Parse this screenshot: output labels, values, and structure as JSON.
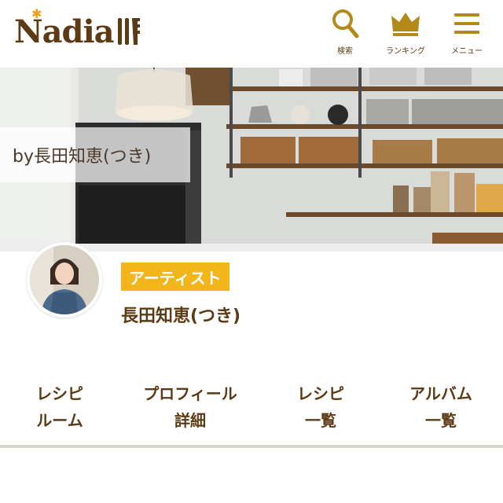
{
  "header": {
    "logo_text": "Nadia",
    "nav": {
      "search_label": "検索",
      "ranking_label": "ランキング",
      "menu_label": "メニュー"
    }
  },
  "cover": {
    "by_label": "by長田知恵(つき)"
  },
  "profile": {
    "tag": "アーティスト",
    "name": "長田知恵(つき)"
  },
  "tabs": [
    {
      "line1": "レシピ",
      "line2": "ルーム"
    },
    {
      "line1": "プロフィール",
      "line2": "詳細"
    },
    {
      "line1": "レシピ",
      "line2": "一覧"
    },
    {
      "line1": "アルバム",
      "line2": "一覧"
    }
  ],
  "colors": {
    "brand_brown": "#5b3a14",
    "accent_yellow": "#f3b61a",
    "star_orange": "#f0a10d"
  }
}
